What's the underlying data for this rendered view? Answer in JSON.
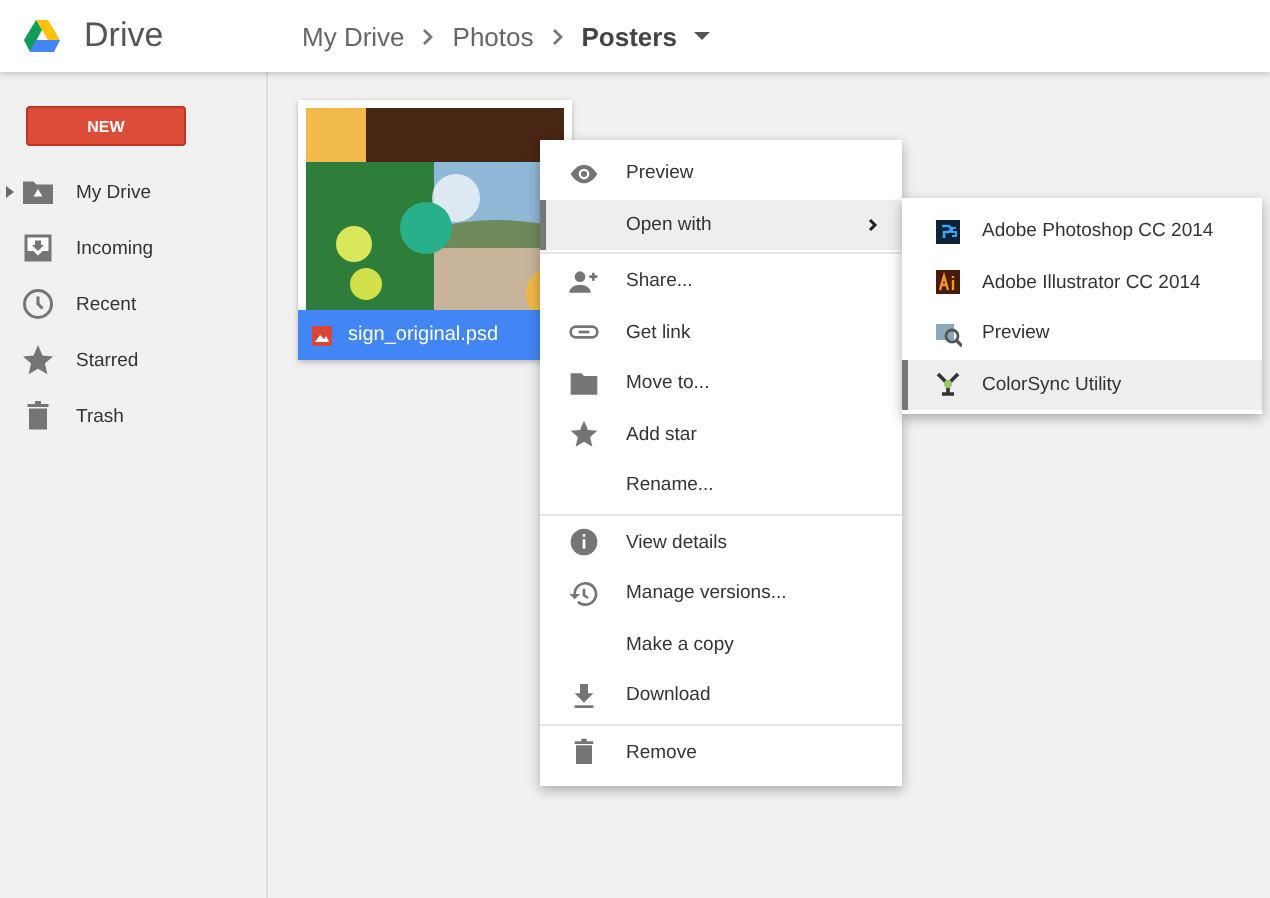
{
  "header": {
    "app_name": "Drive",
    "breadcrumb": [
      {
        "label": "My Drive",
        "current": false
      },
      {
        "label": "Photos",
        "current": false
      },
      {
        "label": "Posters",
        "current": true
      }
    ]
  },
  "sidebar": {
    "new_button": "NEW",
    "items": [
      {
        "label": "My Drive",
        "kind": "drive",
        "expandable": true
      },
      {
        "label": "Incoming",
        "kind": "incoming",
        "expandable": false
      },
      {
        "label": "Recent",
        "kind": "clock",
        "expandable": false
      },
      {
        "label": "Starred",
        "kind": "star",
        "expandable": false
      },
      {
        "label": "Trash",
        "kind": "trash",
        "expandable": false
      }
    ]
  },
  "files": [
    {
      "name": "sign_original.psd",
      "selected": true
    }
  ],
  "context_menu": {
    "sections": [
      [
        {
          "label": "Preview",
          "kind": "eye",
          "selected": false,
          "submenu": false
        },
        {
          "label": "Open with",
          "kind": "plain",
          "selected": true,
          "submenu": true
        }
      ],
      [
        {
          "label": "Share...",
          "kind": "share",
          "selected": false,
          "submenu": false
        },
        {
          "label": "Get link",
          "kind": "link",
          "selected": false,
          "submenu": false
        },
        {
          "label": "Move to...",
          "kind": "folder",
          "selected": false,
          "submenu": false
        },
        {
          "label": "Add star",
          "kind": "star",
          "selected": false,
          "submenu": false
        },
        {
          "label": "Rename...",
          "kind": "plain",
          "selected": false,
          "submenu": false
        }
      ],
      [
        {
          "label": "View details",
          "kind": "info",
          "selected": false,
          "submenu": false
        },
        {
          "label": "Manage versions...",
          "kind": "history",
          "selected": false,
          "submenu": false
        },
        {
          "label": "Make a copy",
          "kind": "plain",
          "selected": false,
          "submenu": false
        },
        {
          "label": "Download",
          "kind": "download",
          "selected": false,
          "submenu": false
        }
      ],
      [
        {
          "label": "Remove",
          "kind": "trash",
          "selected": false,
          "submenu": false
        }
      ]
    ]
  },
  "open_with_menu": {
    "items": [
      {
        "label": "Adobe Photoshop CC 2014",
        "kind": "ps",
        "selected": false
      },
      {
        "label": "Adobe Illustrator CC 2014",
        "kind": "ai",
        "selected": false
      },
      {
        "label": "Preview",
        "kind": "preview",
        "selected": false
      },
      {
        "label": "ColorSync Utility",
        "kind": "colorsync",
        "selected": true
      }
    ]
  }
}
